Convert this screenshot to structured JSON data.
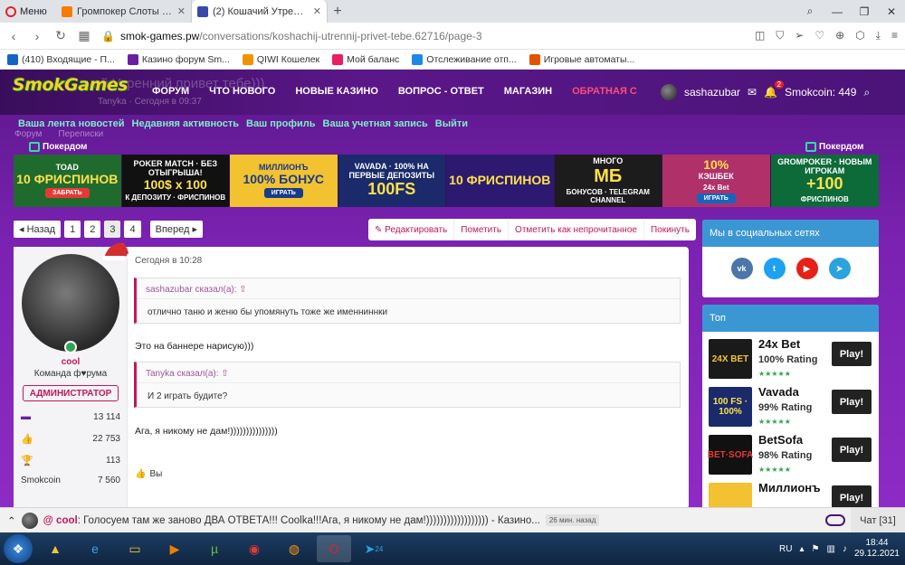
{
  "browser": {
    "menu_label": "Меню",
    "tabs": [
      {
        "label": "Громпокер Слоты на рубл",
        "color": "#f57c00"
      },
      {
        "label": "(2) Кошачий Утренний пр",
        "color": "#3949ab"
      }
    ],
    "url_host": "smok-games.pw",
    "url_path": "/conversations/koshachij-utrennij-privet-tebe.62716/page-3",
    "bookmarks": [
      {
        "label": "(410) Входящие - П...",
        "color": "#1565c0"
      },
      {
        "label": "Казино форум Sm...",
        "color": "#6a1fa0"
      },
      {
        "label": "QIWI Кошелек",
        "color": "#f39200"
      },
      {
        "label": "Мой баланс",
        "color": "#e91e63"
      },
      {
        "label": "Отслеживание отп...",
        "color": "#1e88e5"
      },
      {
        "label": "Игровые автоматы...",
        "color": "#e65100"
      }
    ]
  },
  "site": {
    "logo": "SmokGames",
    "ghost_title": "чий Утренний привет тебе)))",
    "ghost_meta": "Tanyka · Сегодня в 09:37",
    "nav": [
      "ФОРУМ",
      "ЧТО НОВОГО",
      "НОВЫЕ КАЗИНО",
      "ВОПРОС - ОТВЕТ",
      "МАГАЗИН",
      "ОБРАТНАЯ С"
    ],
    "username": "sashazubar",
    "alerts_count": "2",
    "smokcoin": "Smokcoin: 449",
    "subnav": [
      "Ваша лента новостей",
      "Недавняя активность",
      "Ваш профиль",
      "Ваша учетная запись",
      "Выйти"
    ],
    "crumbs": [
      "Форум",
      "Переписки"
    ],
    "pokerdom": "Покердом"
  },
  "banners": [
    {
      "l1": "TOAD",
      "l2": "10 ФРИСПИНОВ",
      "l3": "",
      "btn": "ЗАБРАТЬ",
      "bg": "#1f6b2e",
      "btnc": "#e53935"
    },
    {
      "l1": "POKER MATCH · БЕЗ ОТЫГРЫША!",
      "l2": "100$ x 100",
      "l3": "К ДЕПОЗИТУ · ФРИСПИНОВ",
      "btn": "",
      "bg": "#111111",
      "btnc": "#000"
    },
    {
      "l1": "МИЛЛИОНЪ",
      "l2": "100% БОНУС",
      "l3": "",
      "btn": "ИГРАТЬ",
      "bg": "#f2c230",
      "btnc": "#1a3a8a"
    },
    {
      "l1": "VAVADA · 100% НА ПЕРВЫЕ ДЕПОЗИТЫ",
      "l2": "100FS",
      "l3": "",
      "btn": "",
      "bg": "#1a2a6a",
      "btnc": "#000"
    },
    {
      "l1": "",
      "l2": "10 ФРИСПИНОВ",
      "l3": "",
      "btn": "",
      "bg": "#2c1a70",
      "btnc": "#000"
    },
    {
      "l1": "МНОГО",
      "l2": "МБ",
      "l3": "БОНУСОВ · TELEGRAM CHANNEL",
      "btn": "",
      "bg": "#1c1c1c",
      "btnc": "#000"
    },
    {
      "l1": "10%",
      "l2": "КЭШБЕК",
      "l3": "24x Bet",
      "btn": "ИГРАТЬ",
      "bg": "#b0306a",
      "btnc": "#1565c0"
    },
    {
      "l1": "GROMPOKER · НОВЫМ ИГРОКАМ",
      "l2": "+100",
      "l3": "ФРИСПИНОВ",
      "btn": "",
      "bg": "#0d6b3a",
      "btnc": "#000"
    }
  ],
  "pager": {
    "prev": "◂ Назад",
    "pages": [
      "1",
      "2",
      "3",
      "4"
    ],
    "current_index": 2,
    "next": "Вперед ▸"
  },
  "actions": [
    "✎ Редактировать",
    "Пометить",
    "Отметить как непрочитанное",
    "Покинуть"
  ],
  "post": {
    "author_name": "cool",
    "author_title": "Команда ф♥рума",
    "author_role": "АДМИНИСТРАТОР",
    "stats": [
      {
        "icon": "messages-icon",
        "glyph": "▬",
        "label": "",
        "value": "13 114"
      },
      {
        "icon": "likes-icon",
        "glyph": "👍",
        "label": "",
        "value": "22 753"
      },
      {
        "icon": "trophy-icon",
        "glyph": "🏆",
        "label": "",
        "value": "113"
      },
      {
        "icon": "",
        "glyph": "",
        "label": "Smokcoin",
        "value": "7 560"
      }
    ],
    "time": "Сегодня в 10:28",
    "quote1_head": "sashazubar сказал(а): ⇧",
    "quote1_text": "отлично таню и женю бы упомянуть тоже же именниннки",
    "text1": "Это на баннере нарисую)))",
    "quote2_head": "Tanyka сказал(а): ⇧",
    "quote2_text": "И 2 играть будите?",
    "text2": "Ага, я никому не дам!)))))))))))))))",
    "likes_label": "Вы"
  },
  "sidebar": {
    "social_title": "Мы в социальных сетях",
    "social": [
      {
        "name": "vk-icon",
        "glyph": "vk",
        "color": "#4a76a8"
      },
      {
        "name": "twitter-icon",
        "glyph": "t",
        "color": "#1da1f2"
      },
      {
        "name": "youtube-icon",
        "glyph": "▶",
        "color": "#e62117"
      },
      {
        "name": "telegram-icon",
        "glyph": "➤",
        "color": "#2aa3df"
      }
    ],
    "top_title": "Топ",
    "casinos": [
      {
        "name": "24x Bet",
        "rating": "100% Rating",
        "stars": "★★★★★",
        "play": "Play!",
        "logo": "24X BET",
        "bg": "#1a1a1a",
        "fg": "#f4c430"
      },
      {
        "name": "Vavada",
        "rating": "99% Rating",
        "stars": "★★★★★",
        "play": "Play!",
        "logo": "100 FS · 100%",
        "bg": "#1a2a6a",
        "fg": "#ffe14a"
      },
      {
        "name": "BetSofa",
        "rating": "98% Rating",
        "stars": "★★★★★",
        "play": "Play!",
        "logo": "BET·SOFA",
        "bg": "#111111",
        "fg": "#e53935"
      },
      {
        "name": "Миллионъ",
        "rating": "",
        "stars": "",
        "play": "Play!",
        "logo": "",
        "bg": "#f2c230",
        "fg": "#1a1a1a"
      }
    ]
  },
  "chat": {
    "user": "@ cool",
    "message": ": Голосуем там же заново ДВА ОТВЕТА!!! Coolka!!!Ага, я никому не дам!)))))))))))))))))) - Казино...",
    "ago": "26 мин. назад",
    "count": "Чат [31]"
  },
  "taskbar": {
    "lang": "RU",
    "time": "18:44",
    "date": "29.12.2021",
    "tg_badge": "24"
  }
}
